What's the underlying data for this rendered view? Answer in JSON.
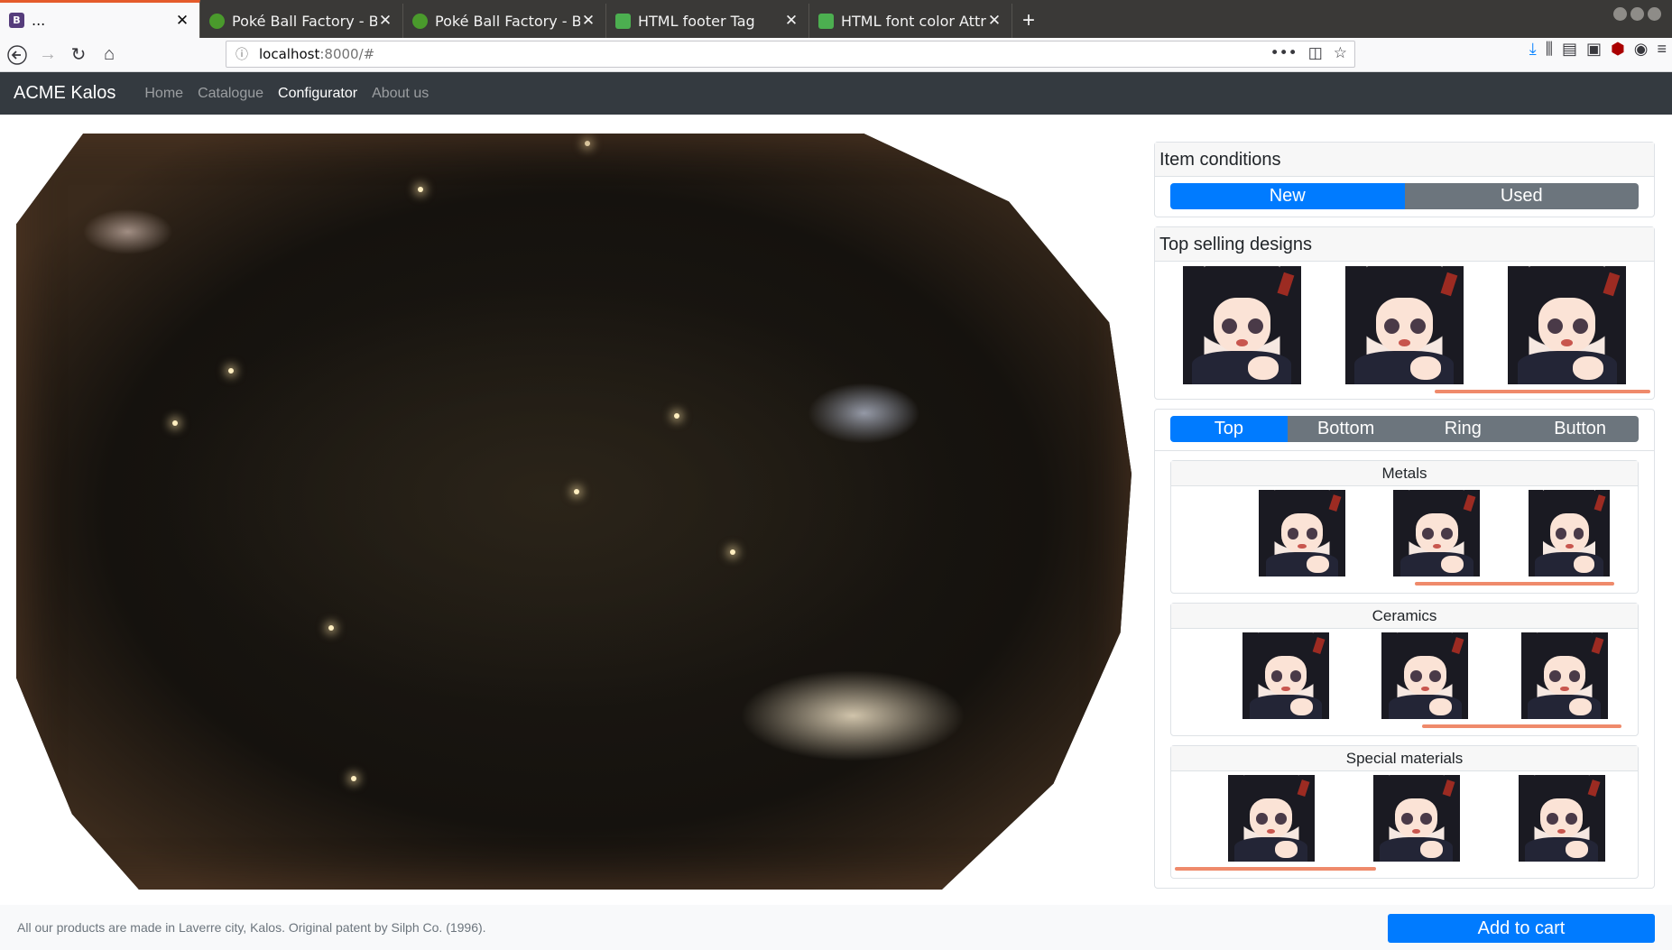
{
  "browser": {
    "tabs": [
      {
        "title": "...",
        "favicon": "bootstrap-icon",
        "favicon_letter": "B",
        "active": true
      },
      {
        "title": "Poké Ball Factory - Bulba",
        "favicon": "bulbapedia-icon",
        "active": false
      },
      {
        "title": "Poké Ball Factory - Bulba",
        "favicon": "bulbapedia-icon",
        "active": false
      },
      {
        "title": "HTML footer Tag",
        "favicon": "w3schools-icon",
        "active": false
      },
      {
        "title": "HTML font color Attribu",
        "favicon": "w3schools-icon",
        "active": false
      }
    ],
    "url_host": "localhost",
    "url_rest": ":8000/#",
    "new_tab_label": "+",
    "colors": {
      "accent": "#e55b2b"
    }
  },
  "nav": {
    "brand": "ACME Kalos",
    "links": [
      "Home",
      "Catalogue",
      "Configurator",
      "About us"
    ],
    "active": "Configurator"
  },
  "conditions": {
    "header": "Item conditions",
    "options": [
      "New",
      "Used"
    ],
    "selected": "New"
  },
  "top_selling": {
    "header": "Top selling designs"
  },
  "parts": {
    "tabs": [
      "Top",
      "Bottom",
      "Ring",
      "Button"
    ],
    "selected": "Top",
    "sections": [
      {
        "title": "Metals"
      },
      {
        "title": "Ceramics"
      },
      {
        "title": "Special materials"
      }
    ]
  },
  "footer": {
    "text": "All our products are made in Laverre city, Kalos. Original patent by Silph Co. (1996).",
    "cart_label": "Add to cart"
  },
  "colors": {
    "primary": "#007bff",
    "secondary": "#6c757d",
    "navbar": "#343a40",
    "scroll_indicator": "#ef8a6b"
  }
}
